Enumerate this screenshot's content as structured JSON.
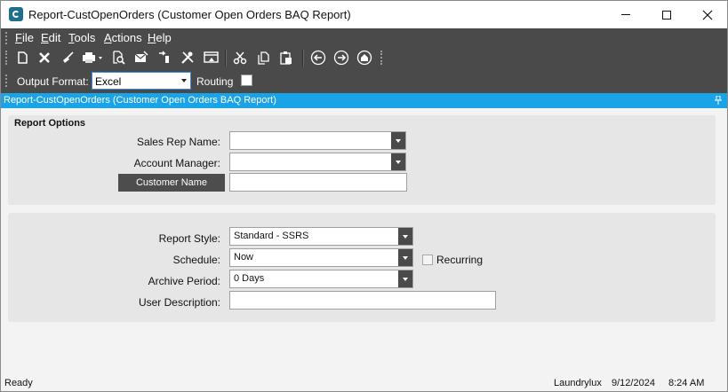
{
  "window": {
    "title": "Report-CustOpenOrders (Customer Open Orders BAQ Report)"
  },
  "menu": {
    "items": [
      {
        "underline": "F",
        "rest": "ile"
      },
      {
        "underline": "E",
        "rest": "dit"
      },
      {
        "underline": "T",
        "rest": "ools"
      },
      {
        "underline": "A",
        "rest": "ctions"
      },
      {
        "underline": "H",
        "rest": "elp"
      }
    ]
  },
  "toolbar": {
    "icons": [
      "new-icon",
      "delete-icon",
      "clear-icon",
      "print-icon",
      "print-preview-icon",
      "email-icon",
      "attachment-icon",
      "tools-icon",
      "report-icon",
      "cut-icon",
      "copy-icon",
      "paste-icon",
      "back-icon",
      "forward-icon",
      "home-icon"
    ]
  },
  "output": {
    "label": "Output Format:",
    "value": "Excel",
    "routing_label": "Routing"
  },
  "sheet": {
    "title": "Report-CustOpenOrders (Customer Open Orders BAQ Report)"
  },
  "report_options": {
    "title": "Report Options",
    "sales_rep_label": "Sales Rep Name:",
    "sales_rep_value": "",
    "account_manager_label": "Account Manager:",
    "account_manager_value": "",
    "customer_name_button": "Customer Name",
    "customer_name_value": ""
  },
  "schedule_options": {
    "report_style_label": "Report Style:",
    "report_style_value": "Standard - SSRS",
    "schedule_label": "Schedule:",
    "schedule_value": "Now",
    "recurring_label": "Recurring",
    "archive_label": "Archive Period:",
    "archive_value": "0 Days",
    "user_description_label": "User Description:",
    "user_description_value": ""
  },
  "status": {
    "state": "Ready",
    "company": "Laundrylux",
    "date": "9/12/2024",
    "time": "8:24 AM"
  }
}
